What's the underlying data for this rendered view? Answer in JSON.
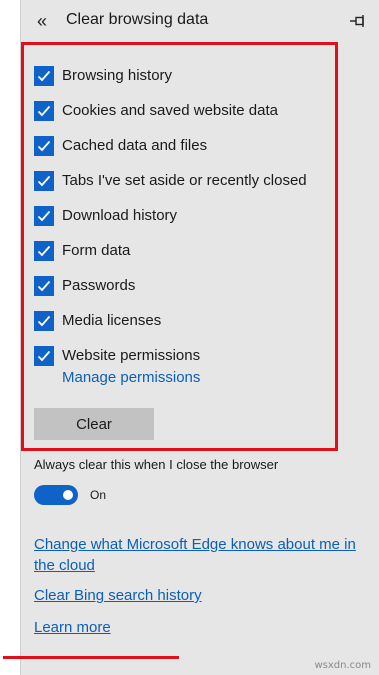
{
  "header": {
    "title": "Clear browsing data",
    "back_icon": "double-chevron-left-icon",
    "pin_icon": "pin-icon"
  },
  "checkboxes": [
    {
      "label": "Browsing history",
      "checked": true
    },
    {
      "label": "Cookies and saved website data",
      "checked": true
    },
    {
      "label": "Cached data and files",
      "checked": true
    },
    {
      "label": "Tabs I've set aside or recently closed",
      "checked": true
    },
    {
      "label": "Download history",
      "checked": true
    },
    {
      "label": "Form data",
      "checked": true
    },
    {
      "label": "Passwords",
      "checked": true
    },
    {
      "label": "Media licenses",
      "checked": true
    },
    {
      "label": "Website permissions",
      "checked": true
    }
  ],
  "manage_permissions_label": "Manage permissions",
  "clear_button_label": "Clear",
  "always_clear": {
    "label": "Always clear this when I close the browser",
    "state_text": "On",
    "enabled": true
  },
  "links": {
    "edge_knows": "Change what Microsoft Edge knows about me in the cloud",
    "clear_bing": "Clear Bing search history",
    "learn_more": "Learn more"
  },
  "watermark": "wsxdn.com",
  "colors": {
    "accent": "#0f62c7",
    "link": "#0b5fb8",
    "highlight": "#e0101a",
    "panel_bg": "#e6e6e6"
  }
}
